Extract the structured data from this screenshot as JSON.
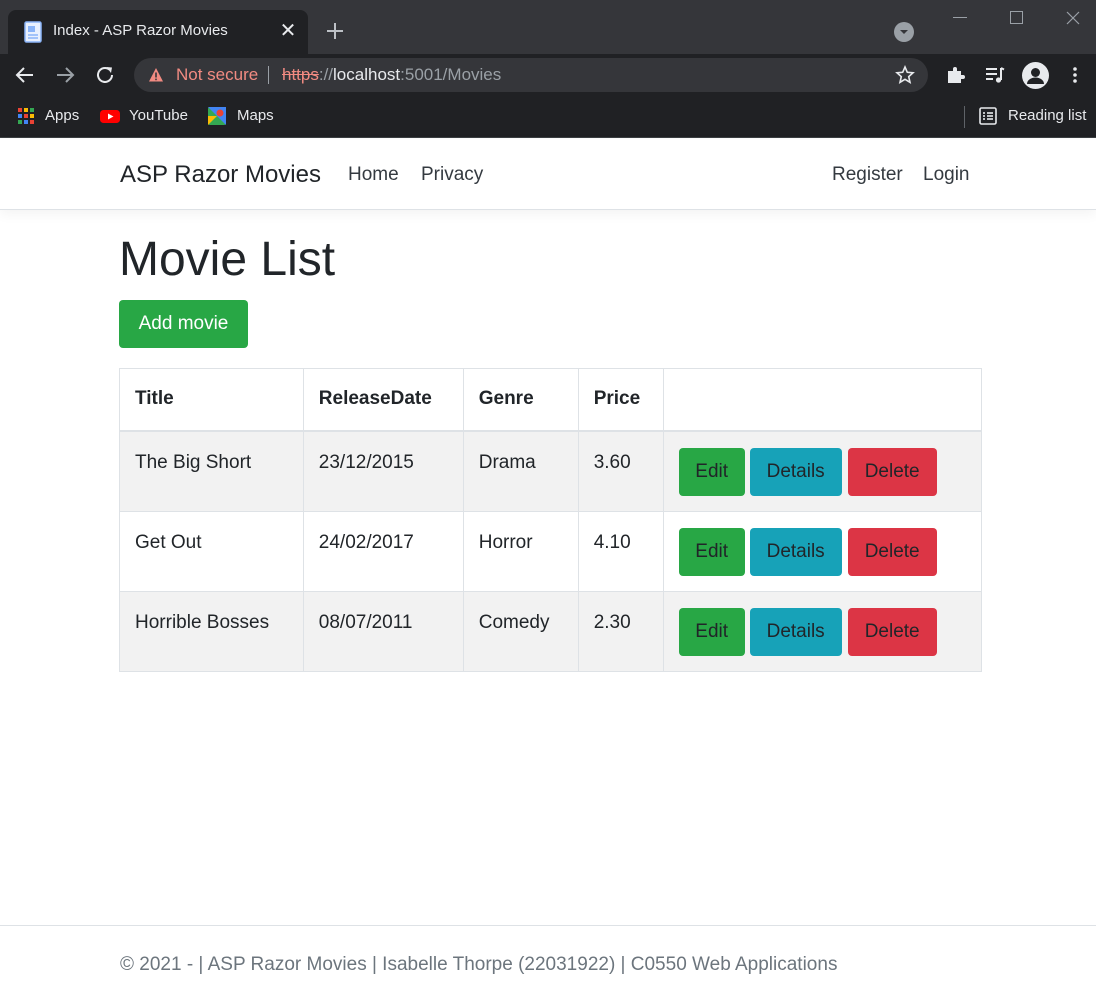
{
  "browser": {
    "tab_title": "Index - ASP Razor Movies",
    "security_label": "Not secure",
    "url_scheme": "https",
    "url_sep": "://",
    "url_host": "localhost",
    "url_rest": ":5001/Movies",
    "bookmarks": {
      "apps": "Apps",
      "youtube": "YouTube",
      "maps": "Maps",
      "reading_list": "Reading list"
    }
  },
  "nav": {
    "brand": "ASP Razor Movies",
    "links": {
      "home": "Home",
      "privacy": "Privacy"
    },
    "auth": {
      "register": "Register",
      "login": "Login"
    }
  },
  "main": {
    "title": "Movie List",
    "add_button": "Add movie",
    "table": {
      "headers": {
        "title": "Title",
        "release_date": "ReleaseDate",
        "genre": "Genre",
        "price": "Price"
      },
      "action_labels": {
        "edit": "Edit",
        "details": "Details",
        "delete": "Delete"
      },
      "rows": [
        {
          "title": "The Big Short",
          "release_date": "23/12/2015",
          "genre": "Drama",
          "price": "3.60"
        },
        {
          "title": "Get Out",
          "release_date": "24/02/2017",
          "genre": "Horror",
          "price": "4.10"
        },
        {
          "title": "Horrible Bosses",
          "release_date": "08/07/2011",
          "genre": "Comedy",
          "price": "2.30"
        }
      ]
    }
  },
  "footer": {
    "text": "© 2021 - | ASP Razor Movies | Isabelle Thorpe (22031922) | C0550 Web Applications"
  },
  "colors": {
    "success": "#28a745",
    "info": "#17a2b8",
    "danger": "#dc3545",
    "browser_dark": "#202124"
  }
}
